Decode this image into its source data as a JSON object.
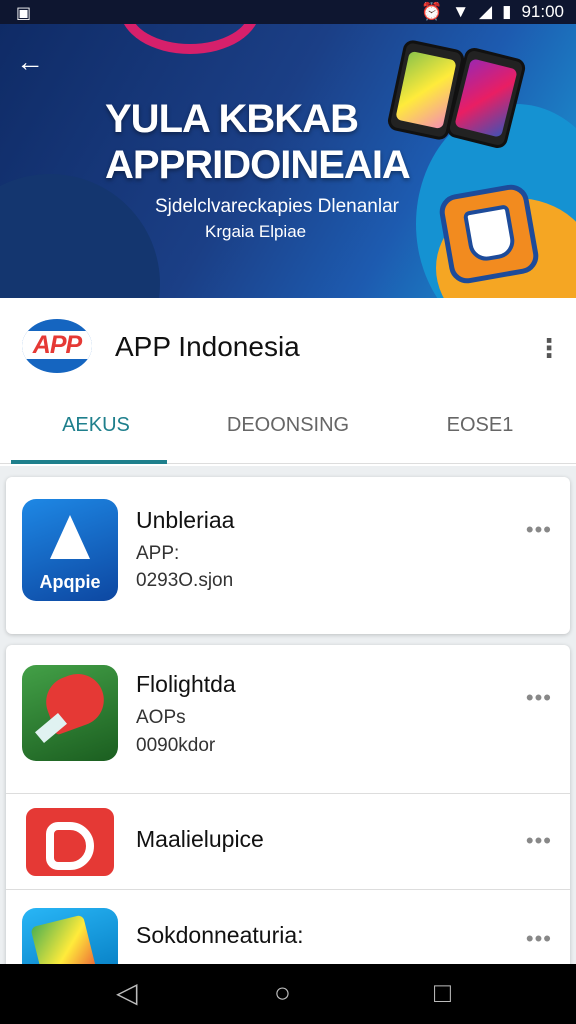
{
  "status_bar": {
    "time": "91:00",
    "icons": [
      "sim-icon",
      "alarm-icon",
      "wifi-icon",
      "signal-icon",
      "battery-icon"
    ]
  },
  "hero": {
    "title_line1": "YULA KBKAB",
    "title_line2": "APPRIDOINEAIA",
    "subtitle_line1": "Sjdelclvareckapies Dlenanlar",
    "subtitle_line2": "Krgaia Elpiae"
  },
  "app": {
    "logo_text": "APP",
    "name": "APP Indonesia"
  },
  "tabs": [
    {
      "label": "AEKUS",
      "active": true
    },
    {
      "label": "DEOONSING",
      "active": false
    },
    {
      "label": "EOSE1",
      "active": false
    }
  ],
  "items": [
    {
      "title": "Unbleriaa",
      "line1": "APP:",
      "line2": "0293O.sjon",
      "icon_label": "Apqpie"
    },
    {
      "title": "Flolightda",
      "line1": "AOPs",
      "line2": "0090kdor"
    },
    {
      "title": "Maalielupice"
    },
    {
      "title": "Sokdonneaturia:"
    }
  ],
  "more_glyph": "•••",
  "colors": {
    "accent": "#1e7f8c",
    "hero_start": "#0f2b66",
    "hero_end": "#1aa0d8"
  }
}
